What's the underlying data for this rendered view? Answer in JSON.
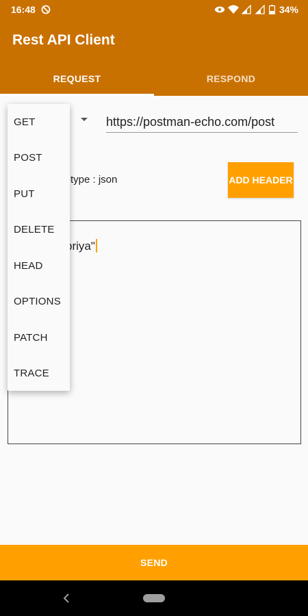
{
  "status_bar": {
    "time": "16:48",
    "battery": "34%",
    "icons": [
      "do-not-disturb-icon",
      "eye-icon",
      "wifi-icon",
      "signal-icon",
      "signal-icon",
      "battery-icon"
    ]
  },
  "app_bar": {
    "title": "Rest API Client"
  },
  "tabs": [
    {
      "label": "REQUEST",
      "active": true
    },
    {
      "label": "RESPOND",
      "active": false
    }
  ],
  "request": {
    "url": "https://postman-echo.com/post",
    "header_text": "-type : json",
    "add_header_label": "ADD HEADER",
    "body_text": "priya\""
  },
  "method_dropdown": {
    "options": [
      "GET",
      "POST",
      "PUT",
      "DELETE",
      "HEAD",
      "OPTIONS",
      "PATCH",
      "TRACE"
    ]
  },
  "send_label": "SEND",
  "colors": {
    "primary": "#c97100",
    "accent": "#ffa000"
  }
}
